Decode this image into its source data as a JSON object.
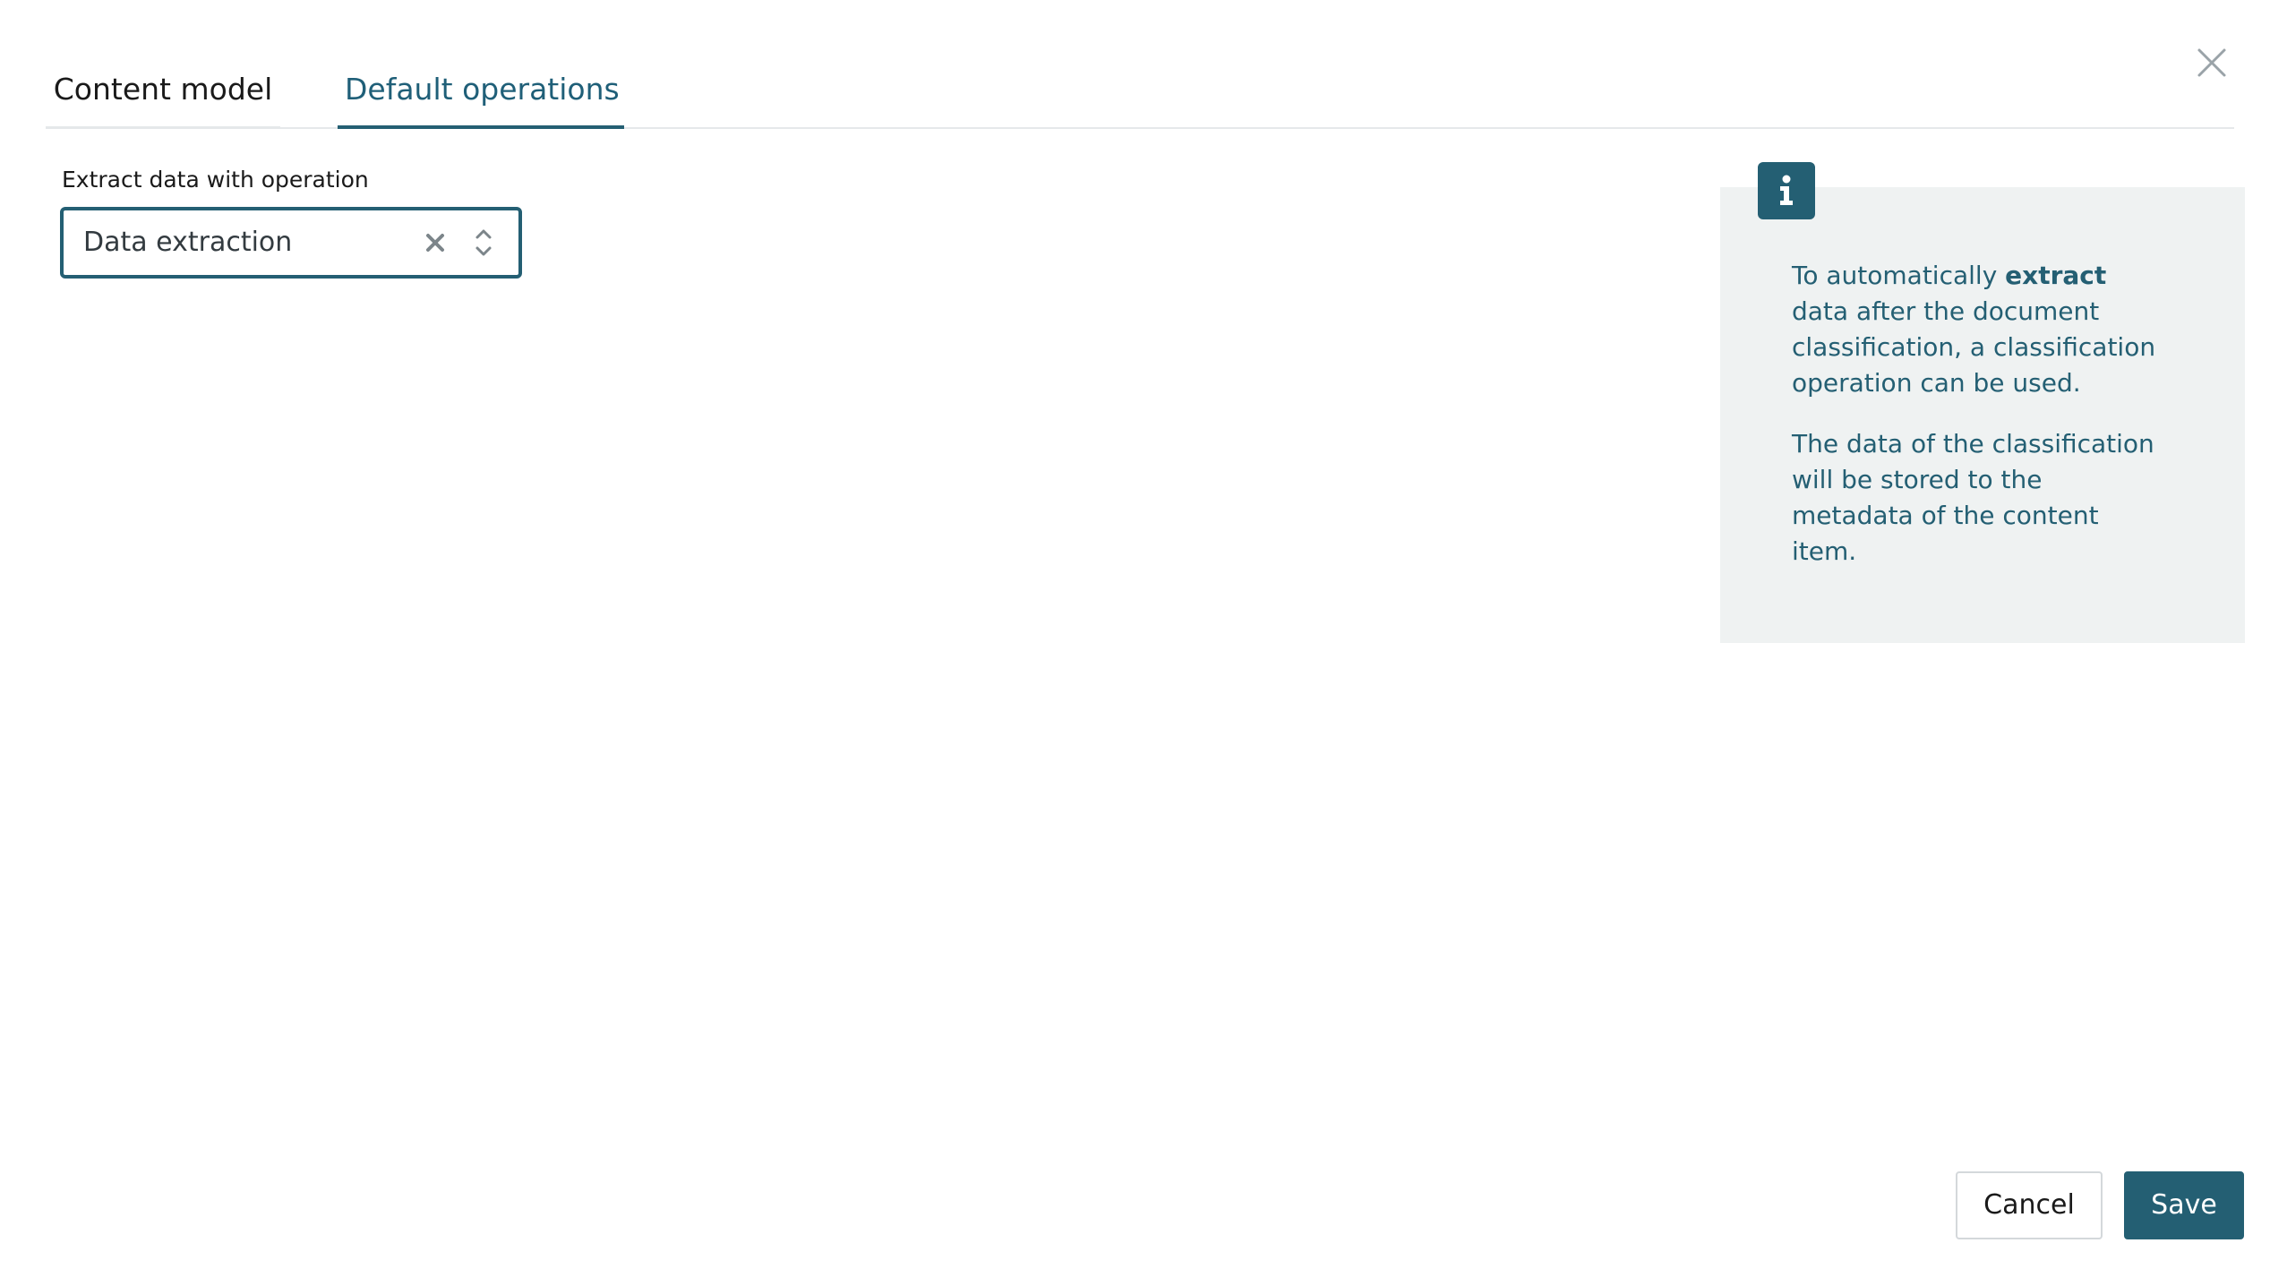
{
  "tabs": [
    {
      "label": "Content model",
      "active": false
    },
    {
      "label": "Default operations",
      "active": true
    }
  ],
  "field": {
    "label": "Extract data with operation",
    "value": "Data extraction"
  },
  "info": {
    "p1_before": "To automatically ",
    "p1_bold": "extract",
    "p1_after": " data after the document classification, a classification operation can be used.",
    "p2": "The data of the classification will be stored to the metadata of the content item."
  },
  "buttons": {
    "cancel": "Cancel",
    "save": "Save"
  },
  "icons": {
    "close": "close-icon",
    "clear": "clear-icon",
    "chevrons": "chevron-up-down-icon",
    "info": "info-icon"
  },
  "colors": {
    "accent": "#245f73",
    "panel_bg": "#eff2f2"
  }
}
